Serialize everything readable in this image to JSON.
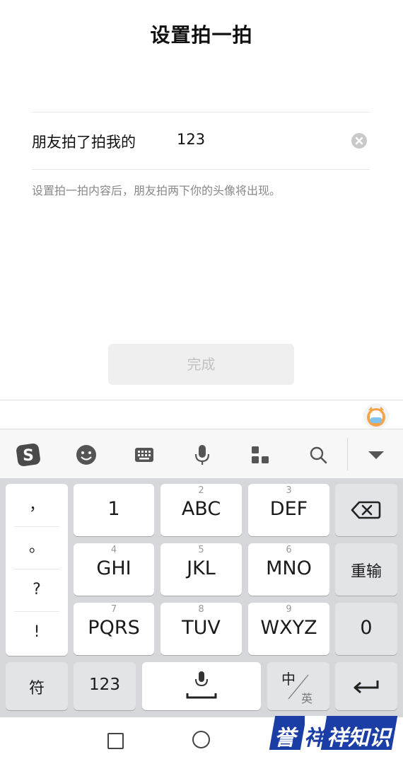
{
  "page": {
    "title": "设置拍一拍",
    "row_label": "朋友拍了拍我的",
    "row_value": "123",
    "hint": "设置拍一拍内容后，朋友拍两下你的头像将出现。",
    "done_label": "完成"
  },
  "toolbar": {
    "icons": [
      "sogou-logo-icon",
      "emoji-icon",
      "keyboard-icon",
      "microphone-icon",
      "apps-grid-icon",
      "search-icon",
      "collapse-triangle-icon"
    ]
  },
  "keyboard": {
    "punctuation": [
      "，",
      "。",
      "?",
      "!"
    ],
    "row1": [
      {
        "sup": "",
        "main": "1"
      },
      {
        "sup": "2",
        "main": "ABC"
      },
      {
        "sup": "3",
        "main": "DEF"
      }
    ],
    "row2": [
      {
        "sup": "4",
        "main": "GHI"
      },
      {
        "sup": "5",
        "main": "JKL"
      },
      {
        "sup": "6",
        "main": "MNO"
      }
    ],
    "row3": [
      {
        "sup": "7",
        "main": "PQRS"
      },
      {
        "sup": "8",
        "main": "TUV"
      },
      {
        "sup": "9",
        "main": "WXYZ"
      }
    ],
    "retype": "重输",
    "zero": "0",
    "symbols": "符",
    "num123": "123",
    "lang_zh": "中",
    "lang_en": "英"
  },
  "watermark": {
    "left": "誉",
    "middle": "祥",
    "right": "祥知识"
  },
  "colors": {
    "keyboard_bg": "#d6d7db",
    "watermark_blue": "#1a3ea6"
  }
}
